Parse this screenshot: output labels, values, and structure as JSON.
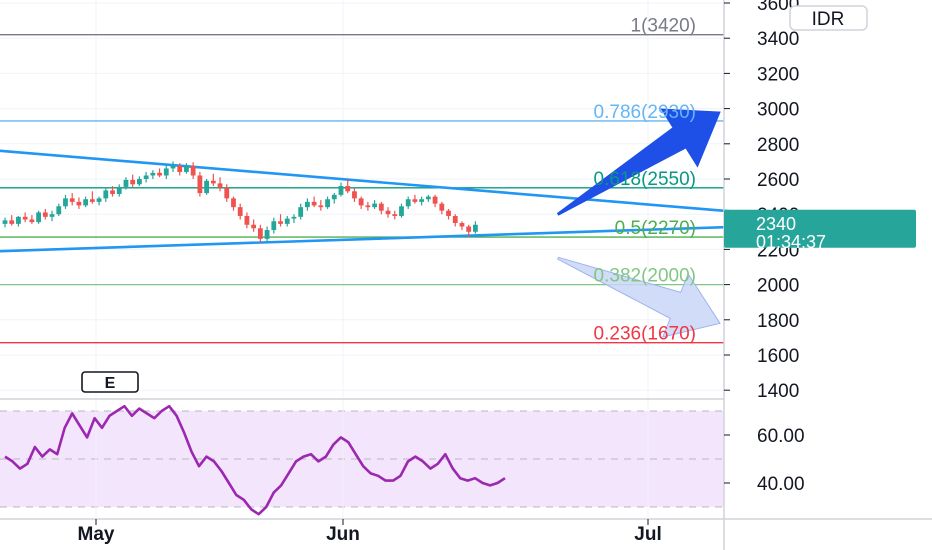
{
  "currency_badge": "IDR",
  "event_badge": "E",
  "last_price": {
    "value_label": "2340",
    "countdown": "01:34:37",
    "value": 2340
  },
  "colors": {
    "up": "#26a69a",
    "down": "#ef5350",
    "trend": "#2196f3",
    "rsi": "#9c27b0",
    "rsi_band": "#f3e5fb",
    "tag": "#26a69a",
    "arrow_up": "#1e4fe6",
    "arrow_down": "#c9d6f7"
  },
  "chart_data": [
    {
      "type": "candlestick",
      "y_ticks": [
        "3600",
        "3400",
        "3200",
        "3000",
        "2800",
        "2600",
        "2400",
        "2200",
        "2000",
        "1800",
        "1600",
        "1400"
      ],
      "ylim": [
        1300,
        3600
      ],
      "x_ticks": [
        "May",
        "Jun",
        "Jul"
      ],
      "fib_levels": [
        {
          "label": "1(3420)",
          "value": 3420,
          "color": "#787b86"
        },
        {
          "label": "0.786(2930)",
          "value": 2930,
          "color": "#64b5f6"
        },
        {
          "label": "0.618(2550)",
          "value": 2550,
          "color": "#089981"
        },
        {
          "label": "0.5(2270)",
          "value": 2270,
          "color": "#4caf50"
        },
        {
          "label": "0.382(2000)",
          "value": 2000,
          "color": "#81c784"
        },
        {
          "label": "0.236(1670)",
          "value": 1670,
          "color": "#f23645"
        }
      ],
      "trendlines": [
        {
          "from": [
            0,
            2760
          ],
          "to": [
            110,
            2410
          ]
        },
        {
          "from": [
            0,
            2190
          ],
          "to": [
            110,
            2330
          ]
        }
      ],
      "projections": [
        {
          "from": [
            82,
            2400
          ],
          "to": [
            110,
            2980
          ],
          "direction": "up"
        },
        {
          "from": [
            82,
            2150
          ],
          "to": [
            110,
            1780
          ],
          "direction": "down"
        }
      ],
      "candles": [
        [
          2345,
          2380,
          2325,
          2365
        ],
        [
          2365,
          2395,
          2335,
          2345
        ],
        [
          2345,
          2390,
          2330,
          2385
        ],
        [
          2385,
          2410,
          2355,
          2370
        ],
        [
          2370,
          2395,
          2345,
          2355
        ],
        [
          2355,
          2420,
          2345,
          2410
        ],
        [
          2410,
          2430,
          2370,
          2385
        ],
        [
          2385,
          2420,
          2360,
          2400
        ],
        [
          2400,
          2460,
          2390,
          2445
        ],
        [
          2445,
          2510,
          2430,
          2490
        ],
        [
          2490,
          2520,
          2450,
          2470
        ],
        [
          2470,
          2495,
          2430,
          2450
        ],
        [
          2450,
          2500,
          2440,
          2485
        ],
        [
          2485,
          2530,
          2460,
          2470
        ],
        [
          2470,
          2500,
          2450,
          2490
        ],
        [
          2490,
          2550,
          2470,
          2535
        ],
        [
          2535,
          2560,
          2500,
          2515
        ],
        [
          2515,
          2570,
          2500,
          2555
        ],
        [
          2555,
          2610,
          2540,
          2595
        ],
        [
          2595,
          2625,
          2555,
          2570
        ],
        [
          2570,
          2615,
          2560,
          2600
        ],
        [
          2600,
          2640,
          2580,
          2620
        ],
        [
          2620,
          2650,
          2600,
          2635
        ],
        [
          2635,
          2660,
          2610,
          2620
        ],
        [
          2620,
          2680,
          2600,
          2660
        ],
        [
          2660,
          2700,
          2640,
          2675
        ],
        [
          2675,
          2690,
          2620,
          2640
        ],
        [
          2640,
          2690,
          2630,
          2675
        ],
        [
          2675,
          2695,
          2600,
          2620
        ],
        [
          2620,
          2640,
          2500,
          2520
        ],
        [
          2520,
          2600,
          2510,
          2590
        ],
        [
          2590,
          2630,
          2560,
          2575
        ],
        [
          2575,
          2610,
          2530,
          2550
        ],
        [
          2550,
          2570,
          2470,
          2490
        ],
        [
          2490,
          2500,
          2420,
          2440
        ],
        [
          2440,
          2460,
          2370,
          2390
        ],
        [
          2390,
          2410,
          2320,
          2340
        ],
        [
          2340,
          2370,
          2300,
          2320
        ],
        [
          2320,
          2340,
          2240,
          2260
        ],
        [
          2260,
          2330,
          2240,
          2310
        ],
        [
          2310,
          2380,
          2290,
          2360
        ],
        [
          2360,
          2400,
          2330,
          2345
        ],
        [
          2345,
          2390,
          2330,
          2375
        ],
        [
          2375,
          2400,
          2350,
          2385
        ],
        [
          2385,
          2460,
          2370,
          2440
        ],
        [
          2440,
          2490,
          2420,
          2470
        ],
        [
          2470,
          2500,
          2440,
          2450
        ],
        [
          2450,
          2480,
          2420,
          2440
        ],
        [
          2440,
          2500,
          2430,
          2485
        ],
        [
          2485,
          2520,
          2460,
          2510
        ],
        [
          2510,
          2580,
          2500,
          2560
        ],
        [
          2560,
          2600,
          2520,
          2530
        ],
        [
          2530,
          2550,
          2470,
          2490
        ],
        [
          2490,
          2500,
          2430,
          2450
        ],
        [
          2450,
          2470,
          2420,
          2440
        ],
        [
          2440,
          2480,
          2430,
          2460
        ],
        [
          2460,
          2470,
          2400,
          2420
        ],
        [
          2420,
          2440,
          2380,
          2400
        ],
        [
          2400,
          2420,
          2370,
          2390
        ],
        [
          2390,
          2460,
          2380,
          2445
        ],
        [
          2445,
          2500,
          2430,
          2485
        ],
        [
          2485,
          2510,
          2460,
          2470
        ],
        [
          2470,
          2500,
          2450,
          2485
        ],
        [
          2485,
          2510,
          2470,
          2500
        ],
        [
          2500,
          2510,
          2440,
          2460
        ],
        [
          2460,
          2470,
          2400,
          2420
        ],
        [
          2420,
          2430,
          2370,
          2390
        ],
        [
          2390,
          2400,
          2330,
          2350
        ],
        [
          2350,
          2360,
          2310,
          2330
        ],
        [
          2330,
          2340,
          2270,
          2300
        ],
        [
          2300,
          2360,
          2290,
          2340
        ]
      ]
    },
    {
      "type": "line",
      "name": "",
      "y_ticks": [
        "60.00",
        "40.00"
      ],
      "ylim": [
        28,
        74
      ],
      "band": [
        30,
        70
      ],
      "midline": 50,
      "values": [
        51,
        49,
        46,
        48,
        55,
        51,
        54,
        52,
        63,
        69,
        64,
        59,
        67,
        63,
        68,
        70,
        72,
        68,
        71,
        69,
        67,
        70,
        72,
        68,
        61,
        53,
        47,
        51,
        49,
        45,
        40,
        35,
        33,
        29,
        27,
        30,
        36,
        39,
        44,
        49,
        51,
        52,
        49,
        51,
        56,
        59,
        57,
        52,
        47,
        44,
        43,
        41,
        41,
        43,
        49,
        51,
        49,
        46,
        48,
        52,
        46,
        42,
        41,
        42,
        40,
        39,
        40,
        42
      ]
    }
  ]
}
